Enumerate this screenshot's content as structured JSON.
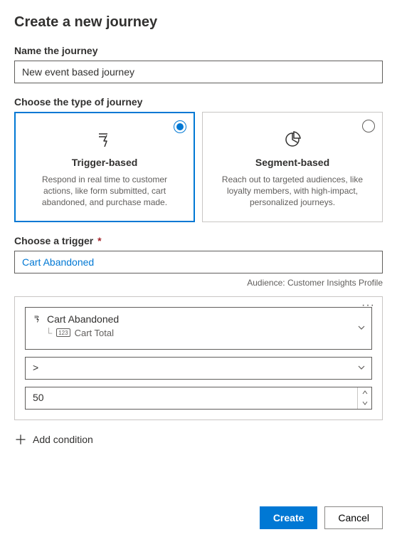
{
  "header": {
    "title": "Create a new journey"
  },
  "name": {
    "label": "Name the journey",
    "value": "New event based journey"
  },
  "type": {
    "label": "Choose the type of journey",
    "trigger": {
      "title": "Trigger-based",
      "desc": "Respond in real time to customer actions, like form submitted, cart abandoned, and purchase made."
    },
    "segment": {
      "title": "Segment-based",
      "desc": "Reach out to targeted audiences, like loyalty members, with high-impact, personalized journeys."
    }
  },
  "trigger": {
    "label": "Choose a trigger",
    "value": "Cart Abandoned",
    "audience_label": "Audience:",
    "audience_value": "Customer Insights Profile"
  },
  "condition": {
    "attr_parent": "Cart Abandoned",
    "attr_child": "Cart Total",
    "operator": ">",
    "value": "50"
  },
  "add_condition": "Add condition",
  "footer": {
    "create": "Create",
    "cancel": "Cancel"
  }
}
